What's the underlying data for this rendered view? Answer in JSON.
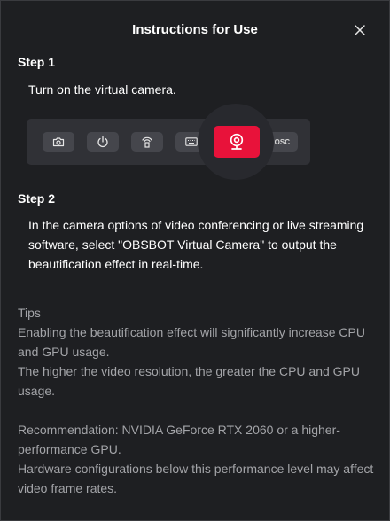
{
  "dialog": {
    "title": "Instructions for Use"
  },
  "step1": {
    "label": "Step 1",
    "text": "Turn on the virtual camera."
  },
  "toolbar": {
    "buttons": [
      "camera-icon",
      "power-icon",
      "streaming-icon",
      "keyboard-icon",
      "webcam-icon"
    ],
    "osc_label": "OSC",
    "active_color": "#e8123a"
  },
  "step2": {
    "label": "Step 2",
    "text": "In the camera options of video conferencing or live streaming software, select \"OBSBOT Virtual Camera\" to output the beautification effect in real-time."
  },
  "tips": {
    "heading": "Tips",
    "line1": "Enabling the beautification effect will significantly increase CPU and GPU usage.",
    "line2": "The higher the video resolution, the greater the CPU and GPU usage.",
    "line3": "Recommendation: NVIDIA GeForce RTX 2060 or a higher-performance GPU.",
    "line4": "Hardware configurations below this performance level may affect video frame rates."
  }
}
